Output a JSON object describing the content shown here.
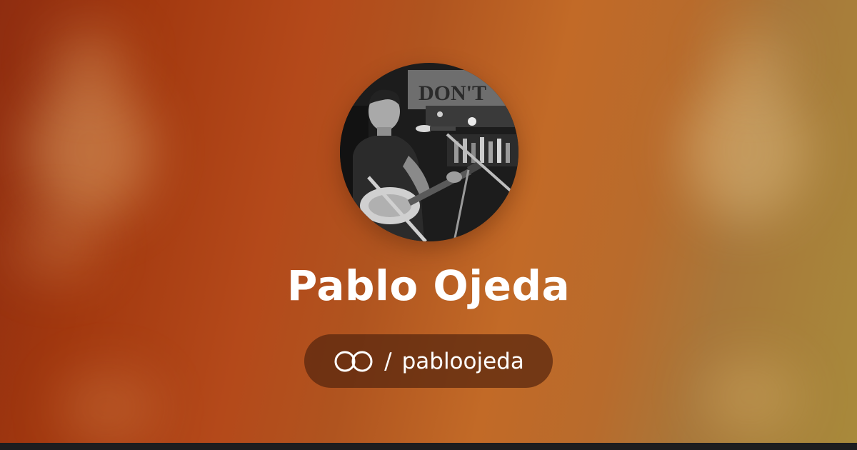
{
  "profile": {
    "name": "Pablo Ojeda",
    "separator": "/",
    "handle": "pabloojeda",
    "avatar_icon": "profile-photo",
    "logo_icon": "linked-rings-icon"
  },
  "colors": {
    "text": "#ffffff",
    "pill": "#56260e",
    "footer": "#1d1d1f"
  }
}
